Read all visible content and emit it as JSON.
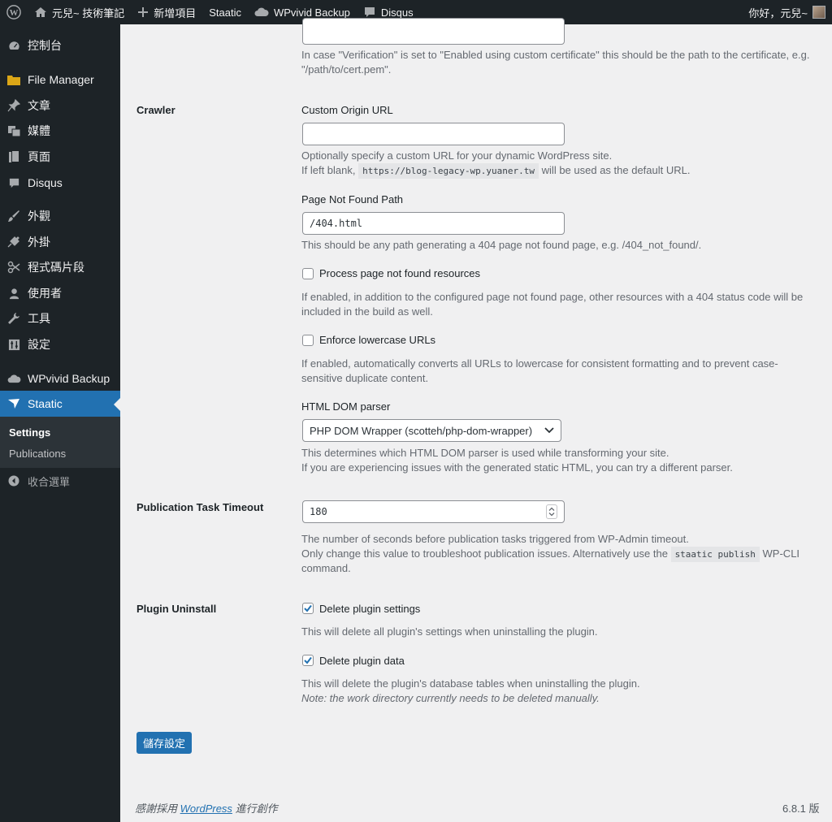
{
  "adminbar": {
    "site_name": "元兒~ 技術筆記",
    "new_label": "新增項目",
    "staatic": "Staatic",
    "wpvivid": "WPvivid Backup",
    "disqus": "Disqus",
    "greeting": "你好，元兒~"
  },
  "sidebar": {
    "items": [
      {
        "label": "控制台",
        "icon": "dashboard-icon"
      },
      {
        "label": "File Manager",
        "icon": "folder-icon"
      },
      {
        "label": "文章",
        "icon": "pin-icon"
      },
      {
        "label": "媒體",
        "icon": "media-icon"
      },
      {
        "label": "頁面",
        "icon": "page-icon"
      },
      {
        "label": "Disqus",
        "icon": "comment-icon"
      },
      {
        "label": "外觀",
        "icon": "brush-icon"
      },
      {
        "label": "外掛",
        "icon": "plugin-icon"
      },
      {
        "label": "程式碼片段",
        "icon": "scissors-icon"
      },
      {
        "label": "使用者",
        "icon": "user-icon"
      },
      {
        "label": "工具",
        "icon": "wrench-icon"
      },
      {
        "label": "設定",
        "icon": "settings-icon"
      },
      {
        "label": "WPvivid Backup",
        "icon": "cloud-icon"
      },
      {
        "label": "Staatic",
        "icon": "staatic-icon"
      }
    ],
    "submenu": [
      "Settings",
      "Publications"
    ],
    "collapse": "收合選單"
  },
  "main": {
    "verification_desc_1": "In case \"Verification\" is set to \"Enabled using custom certificate\" this should be the path to the certificate, e.g.",
    "verification_desc_2": "\"/path/to/cert.pem\".",
    "crawler": {
      "heading": "Crawler",
      "origin_label": "Custom Origin URL",
      "origin_value": "",
      "origin_desc_1": "Optionally specify a custom URL for your dynamic WordPress site.",
      "origin_desc_2a": "If left blank,",
      "origin_desc_code": "https://blog-legacy-wp.yuaner.tw",
      "origin_desc_2b": "will be used as the default URL.",
      "notfound_label": "Page Not Found Path",
      "notfound_value": "/404.html",
      "notfound_desc": "This should be any path generating a 404 page not found page, e.g. /404_not_found/.",
      "process_label": "Process page not found resources",
      "process_checked": false,
      "process_desc_1": "If enabled, in addition to the configured page not found page, other resources with a 404 status code will be",
      "process_desc_2": "included in the build as well.",
      "lowercase_label": "Enforce lowercase URLs",
      "lowercase_checked": false,
      "lowercase_desc_1": "If enabled, automatically converts all URLs to lowercase for consistent formatting and to prevent case-",
      "lowercase_desc_2": "sensitive duplicate content.",
      "parser_label": "HTML DOM parser",
      "parser_value": "PHP DOM Wrapper (scotteh/php-dom-wrapper)",
      "parser_desc_1": "This determines which HTML DOM parser is used while transforming your site.",
      "parser_desc_2": "If you are experiencing issues with the generated static HTML, you can try a different parser."
    },
    "timeout": {
      "heading": "Publication Task Timeout",
      "value": "180",
      "desc_1": "The number of seconds before publication tasks triggered from WP-Admin timeout.",
      "desc_2a": "Only change this value to troubleshoot publication issues. Alternatively use the",
      "desc_code": "staatic publish",
      "desc_2b": "WP-CLI",
      "desc_3": "command."
    },
    "uninstall": {
      "heading": "Plugin Uninstall",
      "settings_label": "Delete plugin settings",
      "settings_checked": true,
      "settings_desc": "This will delete all plugin's settings when uninstalling the plugin.",
      "data_label": "Delete plugin data",
      "data_checked": true,
      "data_desc_1": "This will delete the plugin's database tables when uninstalling the plugin.",
      "data_desc_2": "Note: the work directory currently needs to be deleted manually."
    },
    "save_button": "儲存設定"
  },
  "footer": {
    "thanks_prefix": "感謝採用",
    "wordpress_link": "WordPress",
    "thanks_suffix": "進行創作",
    "version": "6.8.1 版"
  },
  "colors": {
    "accent": "#2271b1",
    "adminbar": "#1d2327",
    "background": "#f0f0f1"
  }
}
